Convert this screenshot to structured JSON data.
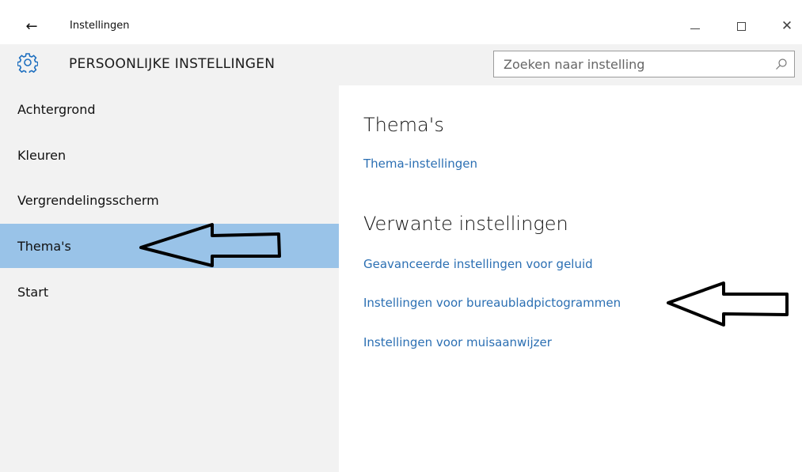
{
  "window": {
    "title": "Instellingen",
    "back_icon": "arrow-left-icon",
    "controls": {
      "minimize_icon": "minimize-icon",
      "maximize_icon": "maximize-icon",
      "close_icon": "close-icon",
      "close_glyph": "✕"
    }
  },
  "header": {
    "icon": "gear-icon",
    "title": "PERSOONLIJKE INSTELLINGEN",
    "search": {
      "placeholder": "Zoeken naar instelling",
      "icon": "search-icon"
    }
  },
  "sidebar": {
    "items": [
      {
        "label": "Achtergrond",
        "active": false
      },
      {
        "label": "Kleuren",
        "active": false
      },
      {
        "label": "Vergrendelingsscherm",
        "active": false
      },
      {
        "label": "Thema's",
        "active": true
      },
      {
        "label": "Start",
        "active": false
      }
    ]
  },
  "main": {
    "themes": {
      "title": "Thema's",
      "links": [
        "Thema-instellingen"
      ]
    },
    "related": {
      "title": "Verwante instellingen",
      "links": [
        "Geavanceerde instellingen voor geluid",
        "Instellingen voor bureaubladpictogrammen",
        "Instellingen voor muisaanwijzer"
      ]
    }
  },
  "annotations": {
    "arrow_icon": "pointer-arrow-icon"
  },
  "colors": {
    "accent_link": "#2b6fb3",
    "sidebar_bg": "#f2f2f2",
    "active_item_bg": "#99c3e8"
  }
}
